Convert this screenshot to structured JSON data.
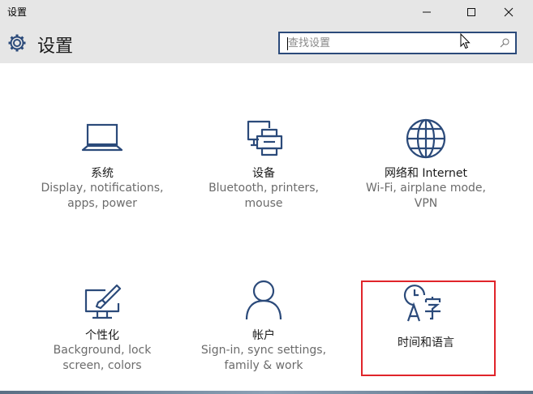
{
  "window": {
    "title": "设置",
    "controls": {
      "minimize": "minimize",
      "maximize": "maximize",
      "close": "close"
    }
  },
  "header": {
    "icon": "gear-icon",
    "title": "设置",
    "search": {
      "placeholder": "查找设置",
      "value": ""
    }
  },
  "tiles": [
    {
      "name": "系统",
      "desc": "Display, notifications,\napps, power",
      "icon": "laptop-icon"
    },
    {
      "name": "设备",
      "desc": "Bluetooth, printers,\nmouse",
      "icon": "devices-icon"
    },
    {
      "name": "网络和 Internet",
      "desc": "Wi-Fi, airplane mode,\nVPN",
      "icon": "globe-icon"
    },
    {
      "name": "个性化",
      "desc": "Background, lock\nscreen, colors",
      "icon": "paint-icon"
    },
    {
      "name": "帐户",
      "desc": "Sign-in, sync settings,\nfamily & work",
      "icon": "person-icon"
    },
    {
      "name": "时间和语言",
      "desc": "",
      "icon": "time-language-icon"
    }
  ],
  "colors": {
    "accent": "#2b4a7a",
    "highlight_border": "#e0242a",
    "chrome": "#e6e6e6"
  }
}
